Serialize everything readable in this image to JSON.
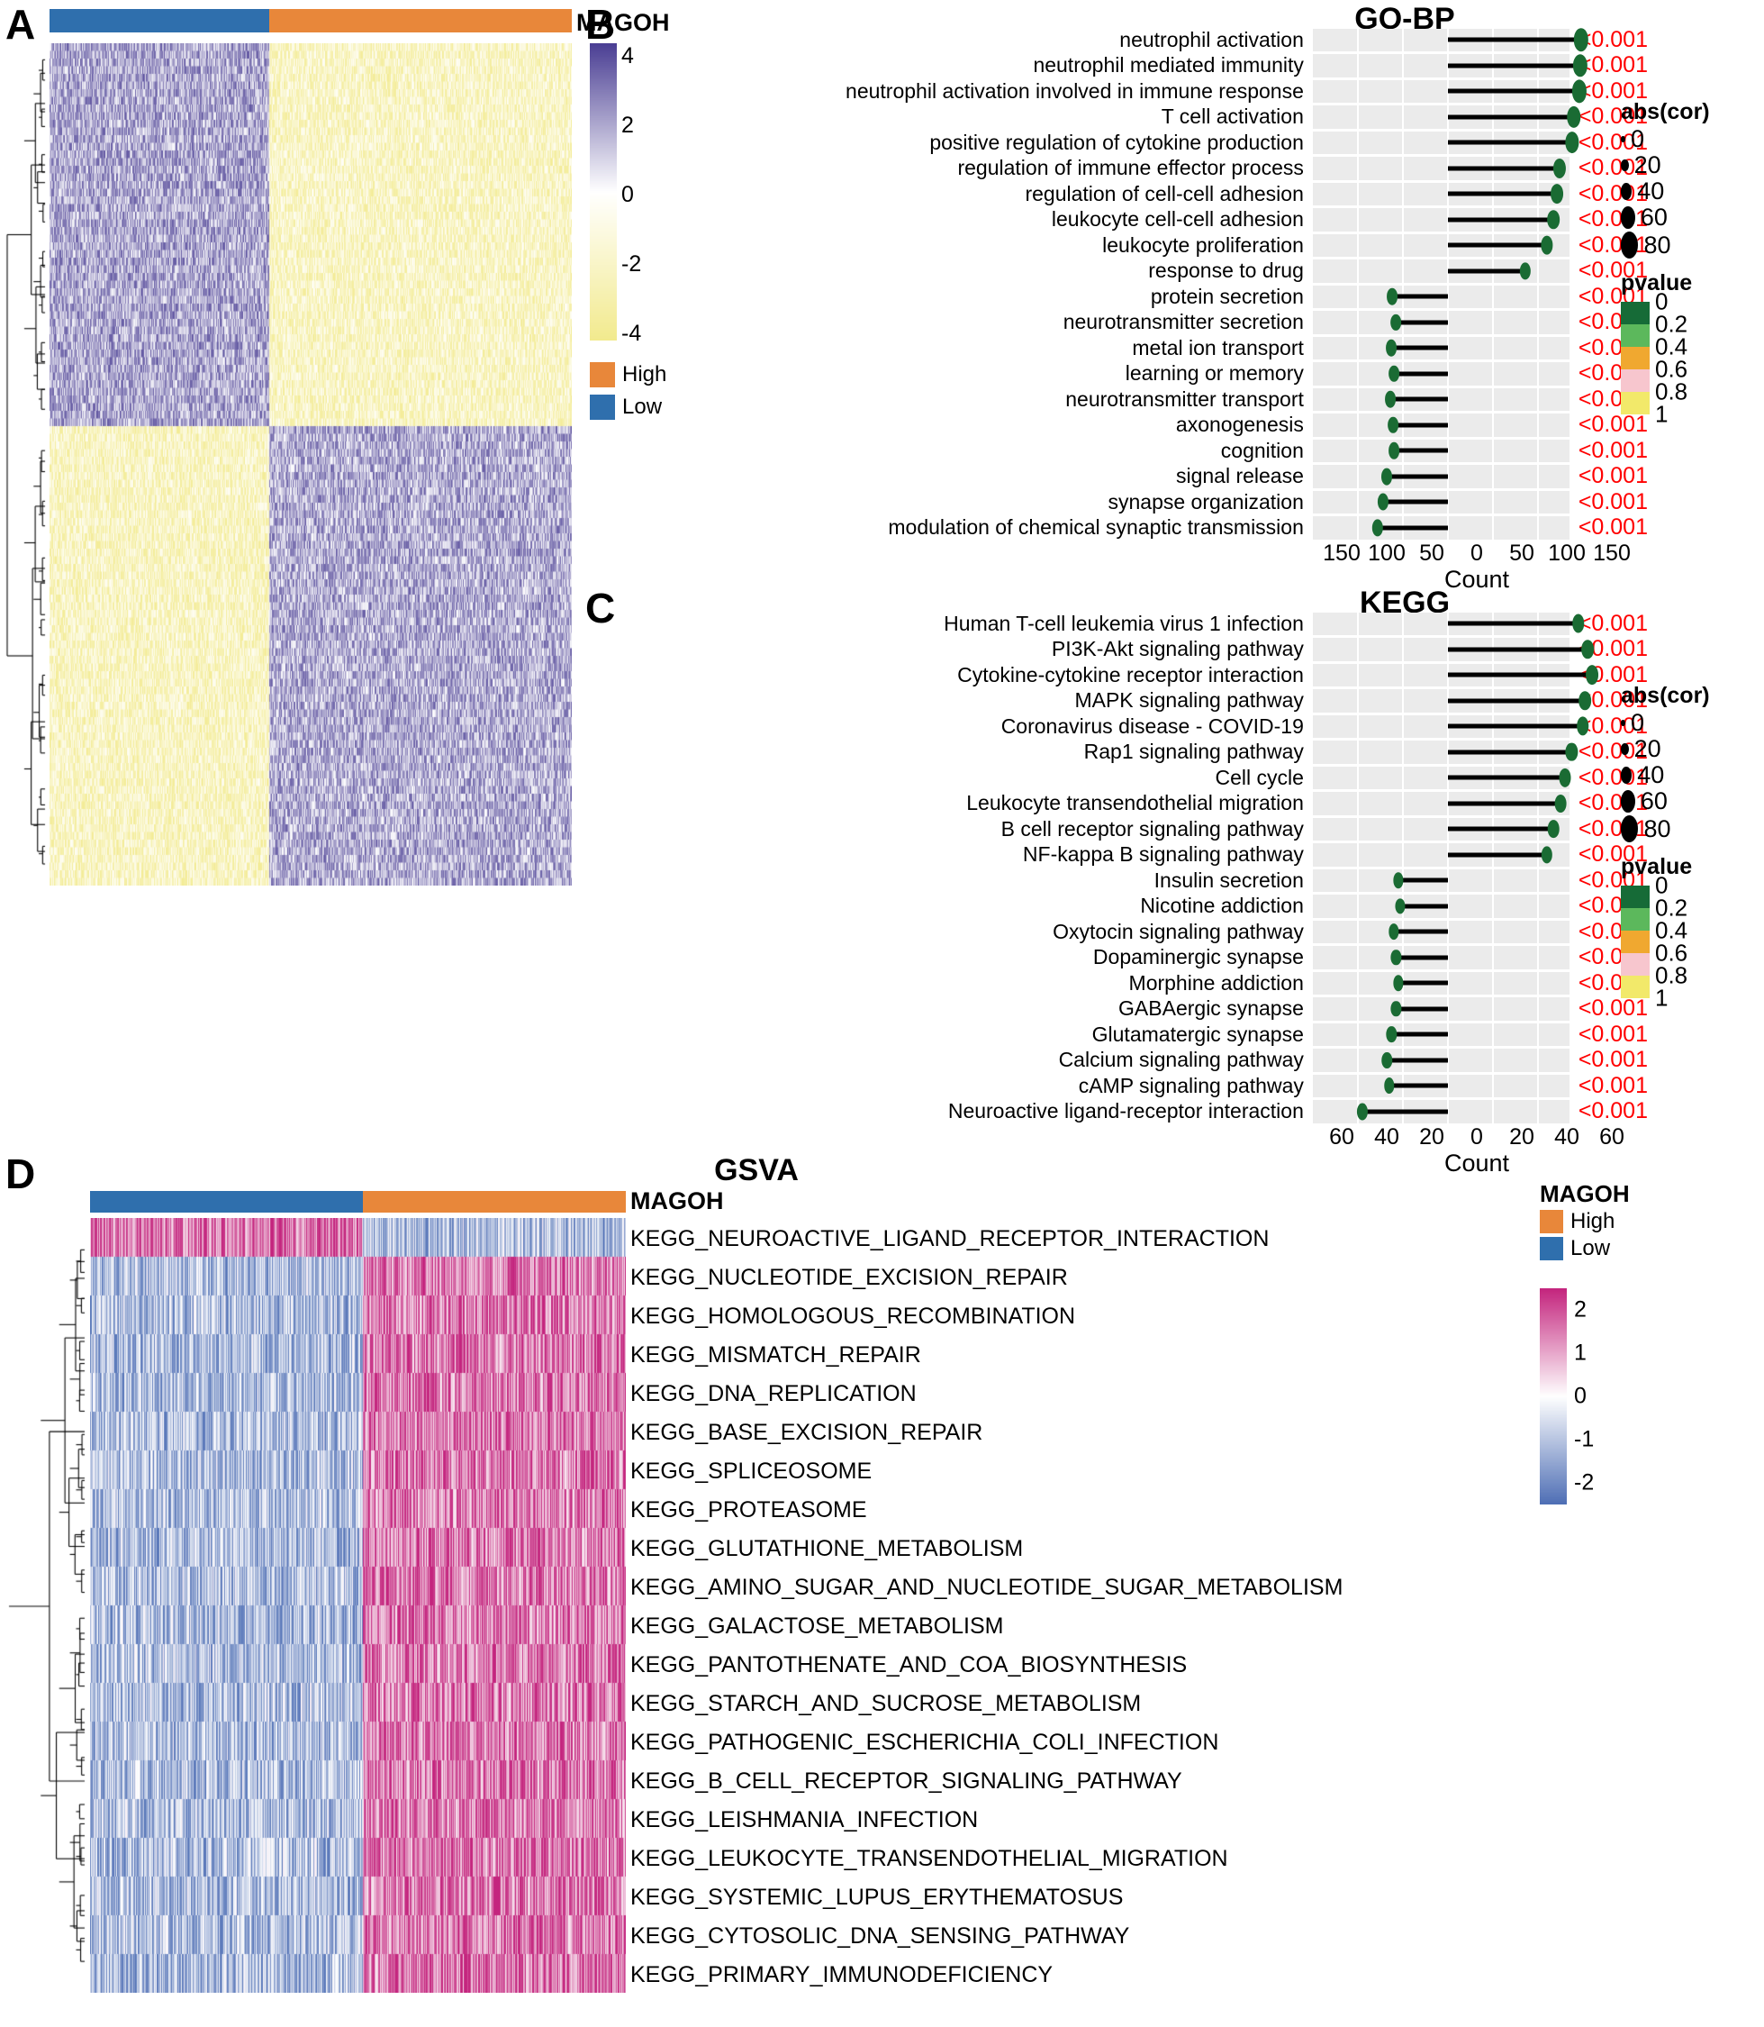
{
  "panels": {
    "a": {
      "letter": "A",
      "group_label": "MAGOH",
      "colorbar_ticks": [
        "4",
        "2",
        "0",
        "-2",
        "-4"
      ],
      "class_legend": [
        {
          "label": "High",
          "color": "#e8873a"
        },
        {
          "label": "Low",
          "color": "#2f6fad"
        }
      ],
      "colors": {
        "high_pos": "#4b3f94",
        "mid": "#ffffff",
        "low_neg": "#f2ea8e"
      },
      "scale_range": [
        -4,
        4
      ]
    },
    "b": {
      "letter": "B",
      "title": "GO-BP",
      "axis_title": "Count",
      "axis_ticks": [
        "150",
        "100",
        "50",
        "0",
        "50",
        "100",
        "150"
      ],
      "legend_size_title": "abs(cor)",
      "legend_sizes": [
        "0",
        "20",
        "40",
        "60",
        "80"
      ],
      "legend_color_title": "pvalue",
      "legend_color_ticks": [
        "0",
        "0.2",
        "0.4",
        "0.6",
        "0.8",
        "1"
      ],
      "legend_colors": [
        "#166b37",
        "#5cb85c",
        "#f0a830",
        "#f7c6ce",
        "#f2e96a"
      ],
      "terms": [
        {
          "label": "neutrophil activation",
          "count": 148,
          "side": "right",
          "pvalue": "<0.001",
          "size": 82
        },
        {
          "label": "neutrophil mediated immunity",
          "count": 147,
          "side": "right",
          "pvalue": "<0.001",
          "size": 81
        },
        {
          "label": "neutrophil activation involved in immune response",
          "count": 146,
          "side": "right",
          "pvalue": "<0.001",
          "size": 80
        },
        {
          "label": "T cell activation",
          "count": 140,
          "side": "right",
          "pvalue": "<0.001",
          "size": 74
        },
        {
          "label": "positive regulation of cytokine production",
          "count": 138,
          "side": "right",
          "pvalue": "<0.001",
          "size": 72
        },
        {
          "label": "regulation of immune effector process",
          "count": 124,
          "side": "right",
          "pvalue": "<0.001",
          "size": 62
        },
        {
          "label": "regulation of cell-cell adhesion",
          "count": 121,
          "side": "right",
          "pvalue": "<0.001",
          "size": 60
        },
        {
          "label": "leukocyte cell-cell adhesion",
          "count": 117,
          "side": "right",
          "pvalue": "<0.001",
          "size": 58
        },
        {
          "label": "leukocyte proliferation",
          "count": 110,
          "side": "right",
          "pvalue": "<0.001",
          "size": 54
        },
        {
          "label": "response to drug",
          "count": 86,
          "side": "right",
          "pvalue": "<0.001",
          "size": 46
        },
        {
          "label": "protein secretion",
          "count": 62,
          "side": "left",
          "pvalue": "<0.001",
          "size": 42
        },
        {
          "label": "neurotransmitter secretion",
          "count": 58,
          "side": "left",
          "pvalue": "<0.001",
          "size": 40
        },
        {
          "label": "metal ion transport",
          "count": 63,
          "side": "left",
          "pvalue": "<0.001",
          "size": 42
        },
        {
          "label": "learning or memory",
          "count": 60,
          "side": "left",
          "pvalue": "<0.001",
          "size": 41
        },
        {
          "label": "neurotransmitter transport",
          "count": 64,
          "side": "left",
          "pvalue": "<0.001",
          "size": 42
        },
        {
          "label": "axonogenesis",
          "count": 61,
          "side": "left",
          "pvalue": "<0.001",
          "size": 41
        },
        {
          "label": "cognition",
          "count": 60,
          "side": "left",
          "pvalue": "<0.001",
          "size": 41
        },
        {
          "label": "signal release",
          "count": 68,
          "side": "left",
          "pvalue": "<0.001",
          "size": 43
        },
        {
          "label": "synapse organization",
          "count": 72,
          "side": "left",
          "pvalue": "<0.001",
          "size": 44
        },
        {
          "label": "modulation of chemical synaptic transmission",
          "count": 78,
          "side": "left",
          "pvalue": "<0.001",
          "size": 46
        }
      ]
    },
    "c": {
      "letter": "C",
      "title": "KEGG",
      "axis_title": "Count",
      "axis_ticks": [
        "60",
        "40",
        "20",
        "0",
        "20",
        "40",
        "60"
      ],
      "legend_size_title": "abs(cor)",
      "legend_sizes": [
        "0",
        "20",
        "40",
        "60",
        "80"
      ],
      "legend_color_title": "pvalue",
      "legend_color_ticks": [
        "0",
        "0.2",
        "0.4",
        "0.6",
        "0.8",
        "1"
      ],
      "legend_colors": [
        "#166b37",
        "#5cb85c",
        "#f0a830",
        "#f7c6ce",
        "#f2e96a"
      ],
      "terms": [
        {
          "label": "Human T-cell leukemia virus 1 infection",
          "count": 58,
          "side": "right",
          "pvalue": "<0.001",
          "size": 56
        },
        {
          "label": "PI3K-Akt signaling pathway",
          "count": 62,
          "side": "right",
          "pvalue": "<0.001",
          "size": 58
        },
        {
          "label": "Cytokine-cytokine receptor interaction",
          "count": 64,
          "side": "right",
          "pvalue": "<0.001",
          "size": 60
        },
        {
          "label": "MAPK signaling pathway",
          "count": 61,
          "side": "right",
          "pvalue": "<0.001",
          "size": 58
        },
        {
          "label": "Coronavirus disease - COVID-19",
          "count": 60,
          "side": "right",
          "pvalue": "<0.001",
          "size": 57
        },
        {
          "label": "Rap1 signaling pathway",
          "count": 55,
          "side": "right",
          "pvalue": "<0.001",
          "size": 54
        },
        {
          "label": "Cell cycle",
          "count": 52,
          "side": "right",
          "pvalue": "<0.001",
          "size": 52
        },
        {
          "label": "Leukocyte transendothelial migration",
          "count": 50,
          "side": "right",
          "pvalue": "<0.001",
          "size": 50
        },
        {
          "label": "B cell receptor signaling pathway",
          "count": 47,
          "side": "right",
          "pvalue": "<0.001",
          "size": 48
        },
        {
          "label": "NF-kappa B signaling pathway",
          "count": 44,
          "side": "right",
          "pvalue": "<0.001",
          "size": 46
        },
        {
          "label": "Insulin secretion",
          "count": 22,
          "side": "left",
          "pvalue": "<0.001",
          "size": 36
        },
        {
          "label": "Nicotine addiction",
          "count": 21,
          "side": "left",
          "pvalue": "<0.001",
          "size": 35
        },
        {
          "label": "Oxytocin signaling pathway",
          "count": 24,
          "side": "left",
          "pvalue": "<0.001",
          "size": 37
        },
        {
          "label": "Dopaminergic synapse",
          "count": 23,
          "side": "left",
          "pvalue": "<0.001",
          "size": 36
        },
        {
          "label": "Morphine addiction",
          "count": 22,
          "side": "left",
          "pvalue": "<0.001",
          "size": 36
        },
        {
          "label": "GABAergic synapse",
          "count": 23,
          "side": "left",
          "pvalue": "<0.001",
          "size": 36
        },
        {
          "label": "Glutamatergic synapse",
          "count": 25,
          "side": "left",
          "pvalue": "<0.001",
          "size": 37
        },
        {
          "label": "Calcium signaling pathway",
          "count": 27,
          "side": "left",
          "pvalue": "<0.001",
          "size": 38
        },
        {
          "label": "cAMP signaling pathway",
          "count": 26,
          "side": "left",
          "pvalue": "<0.001",
          "size": 38
        },
        {
          "label": "Neuroactive ligand-receptor interaction",
          "count": 38,
          "side": "left",
          "pvalue": "<0.001",
          "size": 44
        }
      ]
    },
    "d": {
      "letter": "D",
      "title": "GSVA",
      "group_label": "MAGOH",
      "class_legend_title": "MAGOH",
      "class_legend": [
        {
          "label": "High",
          "color": "#e8873a"
        },
        {
          "label": "Low",
          "color": "#2f6fad"
        }
      ],
      "colorbar_ticks": [
        "2",
        "1",
        "0",
        "-1",
        "-2"
      ],
      "colors": {
        "pos": "#c4257e",
        "mid": "#ffffff",
        "neg": "#4f6fb5"
      },
      "rows": [
        "KEGG_NEUROACTIVE_LIGAND_RECEPTOR_INTERACTION",
        "KEGG_NUCLEOTIDE_EXCISION_REPAIR",
        "KEGG_HOMOLOGOUS_RECOMBINATION",
        "KEGG_MISMATCH_REPAIR",
        "KEGG_DNA_REPLICATION",
        "KEGG_BASE_EXCISION_REPAIR",
        "KEGG_SPLICEOSOME",
        "KEGG_PROTEASOME",
        "KEGG_GLUTATHIONE_METABOLISM",
        "KEGG_AMINO_SUGAR_AND_NUCLEOTIDE_SUGAR_METABOLISM",
        "KEGG_GALACTOSE_METABOLISM",
        "KEGG_PANTOTHENATE_AND_COA_BIOSYNTHESIS",
        "KEGG_STARCH_AND_SUCROSE_METABOLISM",
        "KEGG_PATHOGENIC_ESCHERICHIA_COLI_INFECTION",
        "KEGG_B_CELL_RECEPTOR_SIGNALING_PATHWAY",
        "KEGG_LEISHMANIA_INFECTION",
        "KEGG_LEUKOCYTE_TRANSENDOTHELIAL_MIGRATION",
        "KEGG_SYSTEMIC_LUPUS_ERYTHEMATOSUS",
        "KEGG_CYTOSOLIC_DNA_SENSING_PATHWAY",
        "KEGG_PRIMARY_IMMUNODEFICIENCY"
      ]
    }
  },
  "chart_data": [
    {
      "type": "heatmap",
      "panel": "A",
      "title": "",
      "annotation_track": "MAGOH",
      "groups": [
        "Low",
        "High"
      ],
      "group_colors": [
        "#2f6fad",
        "#e8873a"
      ],
      "zlim": [
        -4,
        4
      ],
      "colorbar_ticks": [
        4,
        2,
        0,
        -2,
        -4
      ],
      "n_columns": 580,
      "low_group_fraction": 0.42,
      "description": "Two-block expression heatmap; upper block purple in Low / yellow in High, lower block reversed."
    },
    {
      "type": "bar",
      "panel": "B",
      "title": "GO-BP",
      "xlabel": "Count",
      "ylabel": "",
      "xlim": [
        -150,
        150
      ],
      "xticks": [
        -150,
        -100,
        -50,
        0,
        50,
        100,
        150
      ],
      "xticklabels": [
        "150",
        "100",
        "50",
        "0",
        "50",
        "100",
        "150"
      ],
      "categories": [
        "neutrophil activation",
        "neutrophil mediated immunity",
        "neutrophil activation involved in immune response",
        "T cell activation",
        "positive regulation of cytokine production",
        "regulation of immune effector process",
        "regulation of cell-cell adhesion",
        "leukocyte cell-cell adhesion",
        "leukocyte proliferation",
        "response to drug",
        "protein secretion",
        "neurotransmitter secretion",
        "metal ion transport",
        "learning or memory",
        "neurotransmitter transport",
        "axonogenesis",
        "cognition",
        "signal release",
        "synapse organization",
        "modulation of chemical synaptic transmission"
      ],
      "values": [
        148,
        147,
        146,
        140,
        138,
        124,
        121,
        117,
        110,
        86,
        -62,
        -58,
        -63,
        -60,
        -64,
        -61,
        -60,
        -68,
        -72,
        -78
      ],
      "pvalues": [
        "<0.001",
        "<0.001",
        "<0.001",
        "<0.001",
        "<0.001",
        "<0.001",
        "<0.001",
        "<0.001",
        "<0.001",
        "<0.001",
        "<0.001",
        "<0.001",
        "<0.001",
        "<0.001",
        "<0.001",
        "<0.001",
        "<0.001",
        "<0.001",
        "<0.001",
        "<0.001"
      ],
      "legend": {
        "size": {
          "name": "abs(cor)",
          "values": [
            0,
            20,
            40,
            60,
            80
          ]
        },
        "color": {
          "name": "pvalue",
          "range": [
            0,
            1
          ],
          "ticks": [
            0,
            0.2,
            0.4,
            0.6,
            0.8,
            1
          ]
        }
      },
      "legend_position": "right"
    },
    {
      "type": "bar",
      "panel": "C",
      "title": "KEGG",
      "xlabel": "Count",
      "ylabel": "",
      "xlim": [
        -60,
        60
      ],
      "xticks": [
        -60,
        -40,
        -20,
        0,
        20,
        40,
        60
      ],
      "xticklabels": [
        "60",
        "40",
        "20",
        "0",
        "20",
        "40",
        "60"
      ],
      "categories": [
        "Human T-cell leukemia virus 1 infection",
        "PI3K-Akt signaling pathway",
        "Cytokine-cytokine receptor interaction",
        "MAPK signaling pathway",
        "Coronavirus disease - COVID-19",
        "Rap1 signaling pathway",
        "Cell cycle",
        "Leukocyte transendothelial migration",
        "B cell receptor signaling pathway",
        "NF-kappa B signaling pathway",
        "Insulin secretion",
        "Nicotine addiction",
        "Oxytocin signaling pathway",
        "Dopaminergic synapse",
        "Morphine addiction",
        "GABAergic synapse",
        "Glutamatergic synapse",
        "Calcium signaling pathway",
        "cAMP signaling pathway",
        "Neuroactive ligand-receptor interaction"
      ],
      "values": [
        58,
        62,
        64,
        61,
        60,
        55,
        52,
        50,
        47,
        44,
        -22,
        -21,
        -24,
        -23,
        -22,
        -23,
        -25,
        -27,
        -26,
        -38
      ],
      "pvalues": [
        "<0.001",
        "<0.001",
        "<0.001",
        "<0.001",
        "<0.001",
        "<0.001",
        "<0.001",
        "<0.001",
        "<0.001",
        "<0.001",
        "<0.001",
        "<0.001",
        "<0.001",
        "<0.001",
        "<0.001",
        "<0.001",
        "<0.001",
        "<0.001",
        "<0.001",
        "<0.001"
      ],
      "legend": {
        "size": {
          "name": "abs(cor)",
          "values": [
            0,
            20,
            40,
            60,
            80
          ]
        },
        "color": {
          "name": "pvalue",
          "range": [
            0,
            1
          ],
          "ticks": [
            0,
            0.2,
            0.4,
            0.6,
            0.8,
            1
          ]
        }
      },
      "legend_position": "right"
    },
    {
      "type": "heatmap",
      "panel": "D",
      "title": "GSVA",
      "annotation_track": "MAGOH",
      "groups": [
        "Low",
        "High"
      ],
      "group_colors": [
        "#2f6fad",
        "#e8873a"
      ],
      "zlim": [
        -2.5,
        2.5
      ],
      "colorbar_ticks": [
        2,
        1,
        0,
        -1,
        -2
      ],
      "rows": [
        "KEGG_NEUROACTIVE_LIGAND_RECEPTOR_INTERACTION",
        "KEGG_NUCLEOTIDE_EXCISION_REPAIR",
        "KEGG_HOMOLOGOUS_RECOMBINATION",
        "KEGG_MISMATCH_REPAIR",
        "KEGG_DNA_REPLICATION",
        "KEGG_BASE_EXCISION_REPAIR",
        "KEGG_SPLICEOSOME",
        "KEGG_PROTEASOME",
        "KEGG_GLUTATHIONE_METABOLISM",
        "KEGG_AMINO_SUGAR_AND_NUCLEOTIDE_SUGAR_METABOLISM",
        "KEGG_GALACTOSE_METABOLISM",
        "KEGG_PANTOTHENATE_AND_COA_BIOSYNTHESIS",
        "KEGG_STARCH_AND_SUCROSE_METABOLISM",
        "KEGG_PATHOGENIC_ESCHERICHIA_COLI_INFECTION",
        "KEGG_B_CELL_RECEPTOR_SIGNALING_PATHWAY",
        "KEGG_LEISHMANIA_INFECTION",
        "KEGG_LEUKOCYTE_TRANSENDOTHELIAL_MIGRATION",
        "KEGG_SYSTEMIC_LUPUS_ERYTHEMATOSUS",
        "KEGG_CYTOSOLIC_DNA_SENSING_PATHWAY",
        "KEGG_PRIMARY_IMMUNODEFICIENCY"
      ],
      "n_columns": 300,
      "low_group_fraction": 0.51,
      "description": "Row 1 (neuroactive ligand) high in Low group; remaining KEGG rows higher in High group."
    }
  ]
}
